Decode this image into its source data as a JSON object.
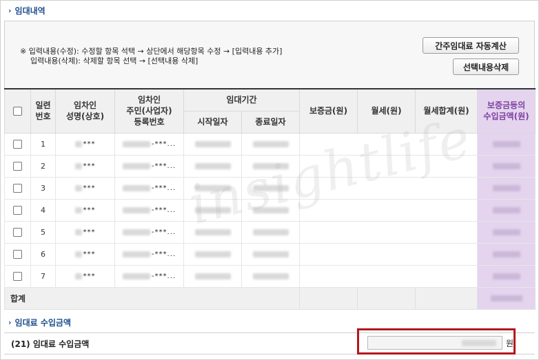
{
  "section1": {
    "title": "임대내역"
  },
  "notice": {
    "line1": "※ 입력내용(수정): 수정할 항목 석택 → 상단에서 해당항목 수정 → [입력내용 추가]",
    "line2": "입력내용(삭제): 삭제할 항목 선택 → [선택내용 삭제]",
    "btn_calc": "간주임대료 자동계산",
    "btn_delete": "선택내용삭제"
  },
  "table": {
    "headers": {
      "serial": "일련\n번호",
      "name": "임차인\n성명(상호)",
      "regno": "임차인\n주민(사업자)\n등록번호",
      "period": "임대기간",
      "start": "시작일자",
      "end": "종료일자",
      "deposit": "보증금(원)",
      "rent": "월세(원)",
      "rent_total": "월세합계(원)",
      "income": "보증금등의\n수입금액(원)"
    },
    "rows": [
      {
        "no": "1",
        "name_mask": "***",
        "reg_mask": "-***..."
      },
      {
        "no": "2",
        "name_mask": "***",
        "reg_mask": "-***..."
      },
      {
        "no": "3",
        "name_mask": "***",
        "reg_mask": "-***..."
      },
      {
        "no": "4",
        "name_mask": "***",
        "reg_mask": "-***..."
      },
      {
        "no": "5",
        "name_mask": "***",
        "reg_mask": "-***..."
      },
      {
        "no": "6",
        "name_mask": "***",
        "reg_mask": "-***..."
      },
      {
        "no": "7",
        "name_mask": "***",
        "reg_mask": "-***..."
      }
    ],
    "total_label": "합계"
  },
  "section2": {
    "title": "임대료 수입금액"
  },
  "income": {
    "label": "(21) 임대료 수입금액",
    "unit": "원"
  },
  "watermark": "insightlife",
  "colors": {
    "accent": "#1f4e8c",
    "purple_col": "#e4d4ee",
    "highlight": "#b5161c"
  }
}
